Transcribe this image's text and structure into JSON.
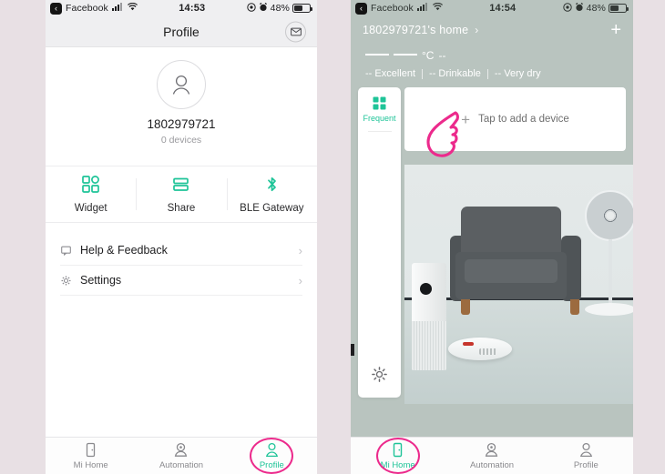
{
  "colors": {
    "accent_teal": "#1ec498",
    "annotation_pink": "#ec2a8c",
    "page_bg": "#e8e0e4",
    "home_bg": "#b9c4bf"
  },
  "left_phone": {
    "status_bar": {
      "back_app": "Facebook",
      "back_glyph": "‹",
      "signal_icon": "cellular-signal-icon",
      "wifi_icon": "wifi-icon",
      "time": "14:53",
      "location_icon": "location-arrow-icon",
      "alarm_icon": "alarm-clock-icon",
      "battery_percent": "48%",
      "battery_icon": "battery-icon"
    },
    "header": {
      "title": "Profile",
      "mail_icon": "envelope-icon"
    },
    "profile": {
      "avatar_icon": "user-avatar-icon",
      "username": "1802979721",
      "device_count": "0 devices"
    },
    "quick_actions": [
      {
        "label": "Widget",
        "icon": "widget-grid-icon"
      },
      {
        "label": "Share",
        "icon": "share-bars-icon"
      },
      {
        "label": "BLE Gateway",
        "icon": "bluetooth-icon"
      }
    ],
    "menu": [
      {
        "label": "Help & Feedback",
        "icon": "help-feedback-icon",
        "chevron": "›"
      },
      {
        "label": "Settings",
        "icon": "gear-icon",
        "chevron": "›"
      }
    ],
    "tabs": [
      {
        "label": "Mi Home",
        "icon": "mi-home-icon",
        "active": false,
        "highlighted": false
      },
      {
        "label": "Automation",
        "icon": "automation-icon",
        "active": false,
        "highlighted": false
      },
      {
        "label": "Profile",
        "icon": "profile-person-icon",
        "active": true,
        "highlighted": true
      }
    ]
  },
  "right_phone": {
    "status_bar": {
      "back_app": "Facebook",
      "back_glyph": "‹",
      "signal_icon": "cellular-signal-icon",
      "wifi_icon": "wifi-icon",
      "time": "14:54",
      "location_icon": "location-arrow-icon",
      "alarm_icon": "alarm-clock-icon",
      "battery_percent": "48%",
      "battery_icon": "battery-icon"
    },
    "header": {
      "home_name": "1802979721's home",
      "chevron": "›",
      "add_icon": "plus-icon"
    },
    "weather": {
      "temperature": "—— ——",
      "unit": "°C",
      "extra": "--",
      "air_quality": "-- Excellent",
      "water_quality": "-- Drinkable",
      "humidity": "-- Very dry"
    },
    "rail": {
      "label": "Frequent",
      "grid_icon": "frequent-grid-icon",
      "gear_icon": "gear-icon"
    },
    "add_card": {
      "plus": "+",
      "label": "Tap to add a device",
      "icon": "plus-icon"
    },
    "promo": {
      "alt_name": "smart-home-room-photo",
      "items": [
        "air-purifier",
        "armchair",
        "pedestal-fan",
        "robot-vacuum"
      ]
    },
    "annotation": {
      "hand_icon": "pointing-hand-cursor"
    },
    "tabs": [
      {
        "label": "Mi Home",
        "icon": "mi-home-icon",
        "active": true,
        "highlighted": true
      },
      {
        "label": "Automation",
        "icon": "automation-icon",
        "active": false,
        "highlighted": false
      },
      {
        "label": "Profile",
        "icon": "profile-person-icon",
        "active": false,
        "highlighted": false
      }
    ]
  }
}
